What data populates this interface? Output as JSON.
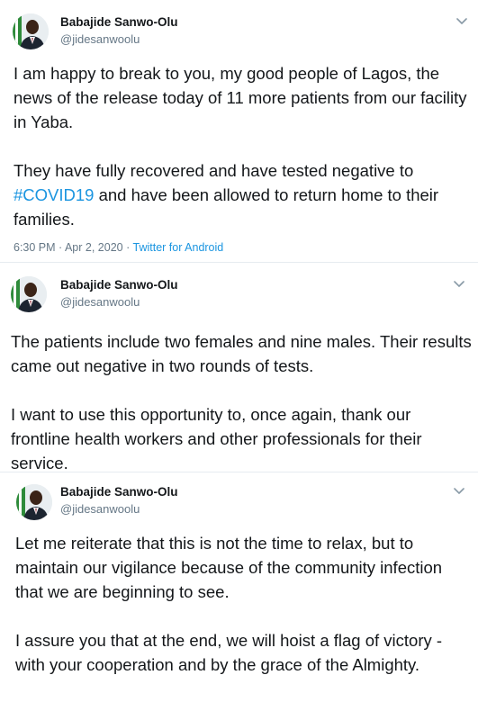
{
  "tweets": [
    {
      "author_name": "Babajide Sanwo-Olu",
      "author_handle": "@jidesanwoolu",
      "paragraphs": [
        "I am happy to break to you, my good people of Lagos, the news of the release today of 11 more patients from our facility in Yaba.",
        ""
      ],
      "para2_before": "They have fully recovered and have tested negative to ",
      "para2_hashtag": "#COVID19",
      "para2_after": " and have been allowed to return home to their families.",
      "timestamp": "6:30 PM · Apr 2, 2020",
      "separator": " · ",
      "source": "Twitter for Android"
    },
    {
      "author_name": "Babajide Sanwo-Olu",
      "author_handle": "@jidesanwoolu",
      "para1": "The patients include two females and nine males. Their results came out negative in two rounds of tests.",
      "para2": "I want to use this opportunity to, once again, thank our frontline health workers and other professionals for their service."
    },
    {
      "author_name": "Babajide Sanwo-Olu",
      "author_handle": "@jidesanwoolu",
      "para1": "Let me reiterate that this is not the time to relax, but to maintain our vigilance because of the community infection that we are beginning to see.",
      "para2": "I assure you that at the end, we will hoist a flag of victory - with your cooperation and by the grace of the Almighty."
    }
  ],
  "icons": {
    "avatar": "profile-photo",
    "menu": "chevron-down-icon"
  },
  "colors": {
    "text": "#14171a",
    "secondary": "#657786",
    "link": "#1b95e0",
    "divider": "#e6ecf0"
  }
}
